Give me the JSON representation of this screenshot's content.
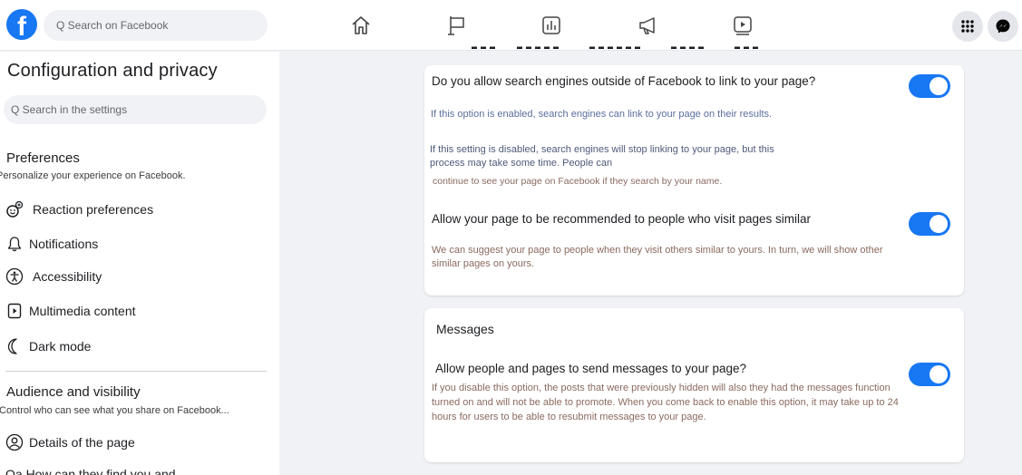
{
  "topbar": {
    "search_placeholder": "Q Search on Facebook",
    "logo_letter": "f"
  },
  "sidebar": {
    "title": "Configuration and privacy",
    "search_placeholder": "Q Search in the settings",
    "preferences": {
      "heading": "Preferences",
      "subtitle": "Personalize your experience on Facebook.",
      "items": [
        {
          "label": "Reaction preferences",
          "icon": "reaction-icon"
        },
        {
          "label": "Notifications",
          "icon": "bell-icon"
        },
        {
          "label": "Accessibility",
          "icon": "accessibility-icon"
        },
        {
          "label": "Multimedia content",
          "icon": "media-icon"
        },
        {
          "label": "Dark mode",
          "icon": "moon-icon"
        }
      ]
    },
    "audience": {
      "heading": "Audience and visibility",
      "subtitle": "Control who can see what you share on Facebook...",
      "items": [
        {
          "label": "Details of the page",
          "icon": "person-circle-icon"
        },
        {
          "label": "Qa How can they find you and",
          "icon": "search-icon"
        }
      ]
    }
  },
  "card1": {
    "opt1": {
      "title": "Do you allow search engines outside of Facebook to link to your page?",
      "desc1": "If this option is enabled, search engines can link to your page on their results.",
      "desc2": "If this setting is disabled, search engines will stop linking to your page, but this process may take some time. People can",
      "desc3": "continue to see your page on Facebook if they search by your name.",
      "enabled": true
    },
    "opt2": {
      "title": "Allow your page to be recommended to people who visit pages similar",
      "desc": "We can suggest your page to people when they visit others similar to yours. In turn, we will show other similar pages on yours.",
      "enabled": true
    }
  },
  "card2": {
    "heading": "Messages",
    "opt": {
      "title": "Allow people and pages to send messages to your page?",
      "desc": "If you disable this option, the posts that were previously hidden will also they had the messages function turned on and will not be able to promote. When you come back to enable this option, it may take up to 24 hours for users to be able to resubmit messages to your page.",
      "enabled": true
    }
  },
  "colors": {
    "accent": "#1877f2",
    "desc_blue": "#5b6f9e",
    "desc_brown": "#8a6a5f"
  }
}
